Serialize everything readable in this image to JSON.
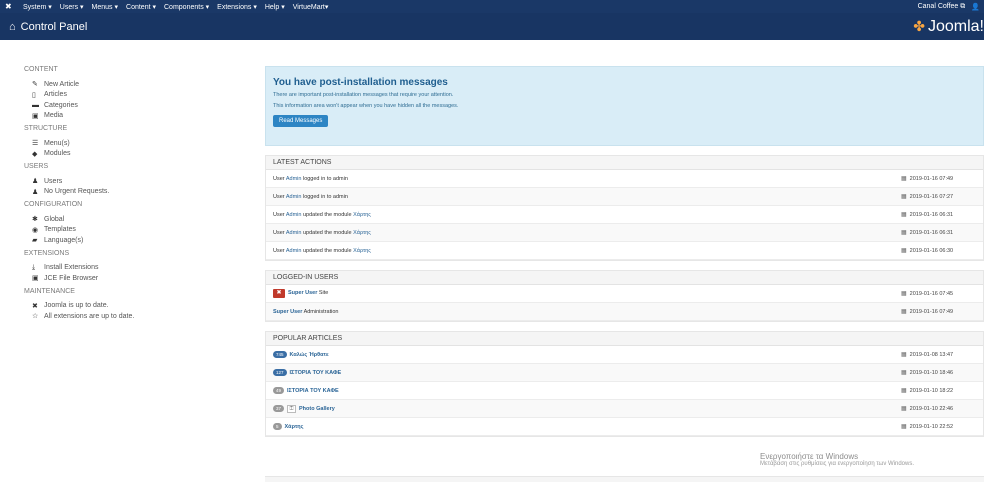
{
  "topbar": {
    "menus": [
      "System ▾",
      "Users ▾",
      "Menus ▾",
      "Content ▾",
      "Components ▾",
      "Extensions ▾",
      "Help ▾",
      "VirtueMart▾"
    ],
    "site_name": "Canal Coffee ⧉",
    "user_icon": "user-icon ▾"
  },
  "header": {
    "title": "Control Panel",
    "logo_text": "Joomla!"
  },
  "sidebar": {
    "content": {
      "heading": "CONTENT",
      "items": [
        "New Article",
        "Articles",
        "Categories",
        "Media"
      ]
    },
    "structure": {
      "heading": "STRUCTURE",
      "items": [
        "Menu(s)",
        "Modules"
      ]
    },
    "users": {
      "heading": "USERS",
      "items": [
        "Users",
        "No Urgent Requests."
      ]
    },
    "configuration": {
      "heading": "CONFIGURATION",
      "items": [
        "Global",
        "Templates",
        "Language(s)"
      ]
    },
    "extensions": {
      "heading": "EXTENSIONS",
      "items": [
        "Install Extensions",
        "JCE File Browser"
      ]
    },
    "maintenance": {
      "heading": "MAINTENANCE",
      "items": [
        "Joomla is up to date.",
        "All extensions are up to date."
      ]
    }
  },
  "alert": {
    "title": "You have post-installation messages",
    "line1": "There are important post-installation messages that require your attention.",
    "line2": "This information area won't appear when you have hidden all the messages.",
    "button": "Read Messages"
  },
  "latest_actions": {
    "heading": "LATEST ACTIONS",
    "rows": [
      {
        "pre": "User ",
        "user": "Admin",
        "mid": " logged in to admin",
        "module": "",
        "date": "2019-01-16 07:49"
      },
      {
        "pre": "User ",
        "user": "Admin",
        "mid": " logged in to admin",
        "module": "",
        "date": "2019-01-16 07:27"
      },
      {
        "pre": "User ",
        "user": "Admin",
        "mid": " updated the module ",
        "module": "Χάρτης",
        "date": "2019-01-16 06:31"
      },
      {
        "pre": "User ",
        "user": "Admin",
        "mid": " updated the module ",
        "module": "Χάρτης",
        "date": "2019-01-16 06:31"
      },
      {
        "pre": "User ",
        "user": "Admin",
        "mid": " updated the module ",
        "module": "Χάρτης",
        "date": "2019-01-16 06:30"
      }
    ]
  },
  "logged_in": {
    "heading": "LOGGED-IN USERS",
    "rows": [
      {
        "name": "Super User",
        "where": "Site",
        "date": "2019-01-16 07:45"
      },
      {
        "name": "Super User",
        "where": "Administration",
        "date": "2019-01-16 07:49"
      }
    ]
  },
  "popular": {
    "heading": "POPULAR ARTICLES",
    "rows": [
      {
        "hits": "745",
        "title": "Καλώς Ήρθατε",
        "date": "2019-01-08 13:47"
      },
      {
        "hits": "127",
        "title": "ΙΣΤΟΡΙΑ ΤΟΥ ΚΑΦΕ",
        "date": "2019-01-10 18:46"
      },
      {
        "hits": "49",
        "title": "ΙΣΤΟΡΙΑ ΤΟΥ ΚΑΦΕ",
        "date": "2019-01-10 18:22"
      },
      {
        "hits": "37",
        "title": "Photo Gallery",
        "date": "2019-01-10 22:46"
      },
      {
        "hits": "5",
        "title": "Χάρτης",
        "date": "2019-01-10 22:52"
      }
    ]
  },
  "watermark": {
    "line1": "Ενεργοποιήστε τα Windows",
    "line2": "Μετάβαση στις ρυθμίσεις για ενεργοποίηση των Windows."
  }
}
